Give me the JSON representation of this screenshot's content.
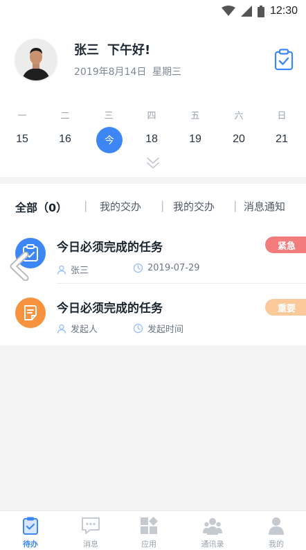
{
  "status_bar": {
    "time": "12:30"
  },
  "header": {
    "name": "张三",
    "greeting": "下午好!",
    "date": "2019年8月14日",
    "weekday": "星期三",
    "task_icon": "clipboard-check-icon"
  },
  "calendar": {
    "weekdays": [
      "一",
      "二",
      "三",
      "四",
      "五",
      "六",
      "日"
    ],
    "days": [
      "15",
      "16",
      "今",
      "18",
      "19",
      "20",
      "21"
    ],
    "today_label": "今",
    "today_index": 2,
    "expand_icon": "double-chevron-down-icon"
  },
  "tabs": {
    "items": [
      "全部（0）",
      "我的交办",
      "我的交办",
      "消息通知"
    ],
    "separator": "|",
    "active_index": 0
  },
  "tasks": [
    {
      "title": "今日必须完成的任务",
      "person": "张三",
      "date": "2019-07-29",
      "badge": "紧急",
      "badge_color": "#f27c7c",
      "icon_color": "#3d86f5",
      "icon": "clipboard-check-icon"
    },
    {
      "title": "今日必须完成的任务",
      "person": "发起人",
      "date": "发起时间",
      "badge": "重要",
      "badge_color": "#fbc99a",
      "icon_color": "#f7923f",
      "icon": "document-edit-icon"
    }
  ],
  "tabbar": {
    "items": [
      {
        "label": "待办",
        "icon": "clipboard-check-icon"
      },
      {
        "label": "消息",
        "icon": "chat-bubble-icon"
      },
      {
        "label": "应用",
        "icon": "apps-grid-icon"
      },
      {
        "label": "通讯录",
        "icon": "contacts-icon"
      },
      {
        "label": "我的",
        "icon": "user-icon"
      }
    ],
    "active_index": 0,
    "active_color": "#3d86f5",
    "inactive_color": "#c5cad0"
  }
}
